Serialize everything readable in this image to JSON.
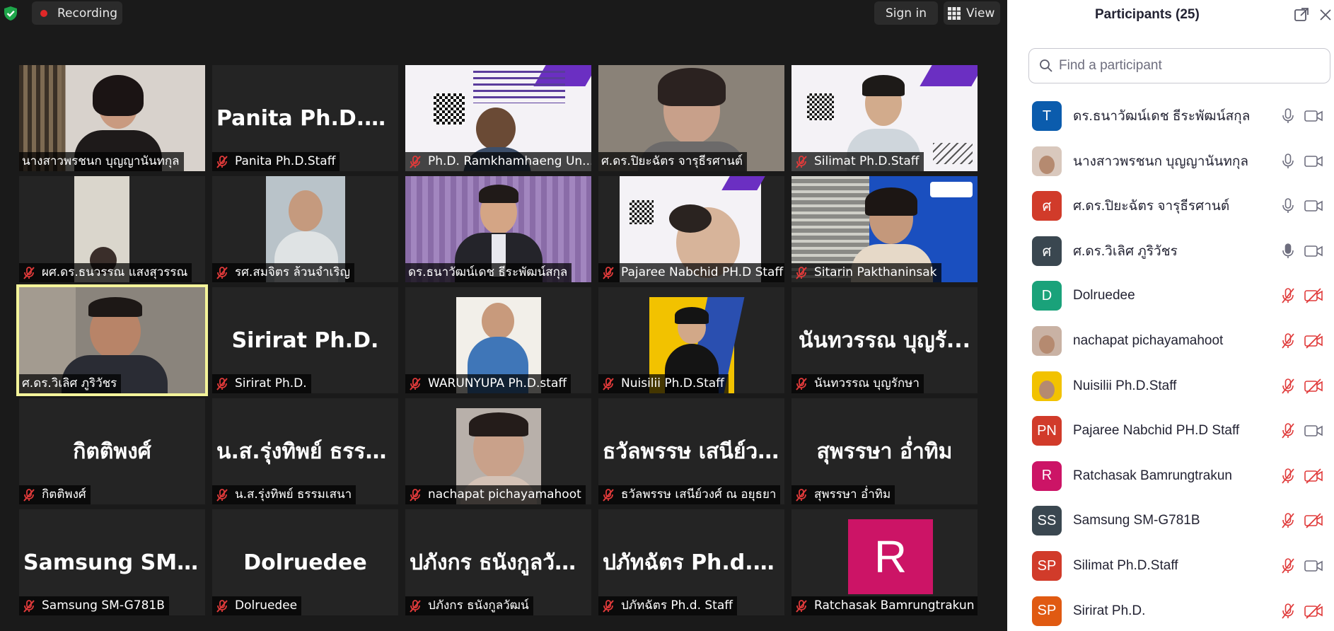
{
  "topbar": {
    "recording_label": "Recording",
    "signin_label": "Sign in",
    "view_label": "View",
    "colors": {
      "recording_dot": "#e02828",
      "shield": "#1ea54a"
    }
  },
  "tiles": [
    {
      "name": "นางสาวพรชนก บุญญานันทกุล",
      "muted": false,
      "kind": "video",
      "scene": "woman-office"
    },
    {
      "name": "Panita Ph.D.Staff",
      "muted": true,
      "kind": "text",
      "big": "Panita Ph.D.Staff"
    },
    {
      "name": "Ph.D. Ramkhamhaeng Un...",
      "muted": true,
      "kind": "video",
      "scene": "poster-man"
    },
    {
      "name": "ศ.ดร.ปิยะฉัตร จารุธีรศานต์",
      "muted": false,
      "kind": "video",
      "scene": "woman-glasses"
    },
    {
      "name": "Silimat Ph.D.Staff",
      "muted": true,
      "kind": "video",
      "scene": "poster-person"
    },
    {
      "name": "ผศ.ดร.ธนวรรณ แสงสุวรรณ",
      "muted": true,
      "kind": "video",
      "scene": "dark-room"
    },
    {
      "name": "รศ.สมจิตร ล้วนจำเริญ",
      "muted": true,
      "kind": "video",
      "scene": "older-man"
    },
    {
      "name": "ดร.ธนาวัฒน์เดช ธีระพัฒน์สกุล",
      "muted": false,
      "kind": "video",
      "scene": "man-purple"
    },
    {
      "name": "Pajaree Nabchid PH.D Staff",
      "muted": true,
      "kind": "video",
      "scene": "poster-face"
    },
    {
      "name": "Sitarin Pakthaninsak",
      "muted": true,
      "kind": "video",
      "scene": "blue-phd"
    },
    {
      "name": "ศ.ดร.วิเลิศ ภูริวัชร",
      "muted": false,
      "kind": "video",
      "scene": "speaker",
      "active": true
    },
    {
      "name": "Sirirat Ph.D.",
      "muted": true,
      "kind": "text",
      "big": "Sirirat Ph.D."
    },
    {
      "name": "WARUNYUPA Ph.D.staff",
      "muted": true,
      "kind": "video",
      "scene": "photo-woman"
    },
    {
      "name": "Nuisilii Ph.D.Staff",
      "muted": true,
      "kind": "video",
      "scene": "phd-yellow"
    },
    {
      "name": "นันทวรรณ บุญรักษา",
      "muted": true,
      "kind": "text",
      "big": "นันทวรรณ บุญรั..."
    },
    {
      "name": "กิตติพงศ์",
      "muted": true,
      "kind": "text",
      "big": "กิตติพงศ์"
    },
    {
      "name": "น.ส.รุ่งทิพย์ ธรรมเสนา",
      "muted": true,
      "kind": "text",
      "big": "น.ส.รุ่งทิพย์ ธรรม..."
    },
    {
      "name": "nachapat pichayamahoot",
      "muted": true,
      "kind": "video",
      "scene": "photo-glasses"
    },
    {
      "name": "ธวัลพรรษ เสนีย์วงศ์ ณ อยุธยา",
      "muted": true,
      "kind": "text",
      "big": "ธวัลพรรษ เสนีย์ว..."
    },
    {
      "name": "สุพรรษา อ่ำทิม",
      "muted": true,
      "kind": "text",
      "big": "สุพรรษา อ่ำทิม"
    },
    {
      "name": "Samsung SM-G781B",
      "muted": true,
      "kind": "text",
      "big": "Samsung  SM-G..."
    },
    {
      "name": "Dolruedee",
      "muted": true,
      "kind": "text",
      "big": "Dolruedee"
    },
    {
      "name": "ปภังกร ธนังกูลวัฒน์",
      "muted": true,
      "kind": "text",
      "big": "ปภังกร ธนังกูลวัฒน์"
    },
    {
      "name": "ปภัทฉัตร Ph.d. Staff",
      "muted": true,
      "kind": "text",
      "big": "ปภัทฉัตร Ph.d. S..."
    },
    {
      "name": "Ratchasak Bamrungtrakun",
      "muted": true,
      "kind": "avatar",
      "big": "R",
      "color": "#cc1466"
    }
  ],
  "panel": {
    "title": "Participants (25)",
    "search_placeholder": "Find a participant",
    "participants": [
      {
        "name": "ดร.ธนาวัฒน์เดช ธีระพัฒน์สกุล",
        "initials": "T",
        "color": "#0b5cad",
        "mic": "on",
        "cam": "on"
      },
      {
        "name": "นางสาวพรชนก บุญญานันทกุล",
        "initials": "",
        "color": "#d9c8bd",
        "photo": true,
        "mic": "on",
        "cam": "on"
      },
      {
        "name": "ศ.ดร.ปิยะฉัตร จารุธีรศานต์",
        "initials": "ศ",
        "color": "#d13b2a",
        "mic": "on",
        "cam": "on"
      },
      {
        "name": "ศ.ดร.วิเลิศ ภูริวัชร",
        "initials": "ศ",
        "color": "#3a4750",
        "mic": "active",
        "cam": "on"
      },
      {
        "name": "Dolruedee",
        "initials": "D",
        "color": "#1aa27a",
        "mic": "off",
        "cam": "off"
      },
      {
        "name": "nachapat pichayamahoot",
        "initials": "",
        "color": "#c9b2a4",
        "photo": true,
        "mic": "off",
        "cam": "off"
      },
      {
        "name": "Nuisilii Ph.D.Staff",
        "initials": "",
        "color": "#f2c200",
        "photo": true,
        "mic": "off",
        "cam": "off"
      },
      {
        "name": "Pajaree Nabchid PH.D Staff",
        "initials": "PN",
        "color": "#d13b2a",
        "mic": "off",
        "cam": "on"
      },
      {
        "name": "Ratchasak Bamrungtrakun",
        "initials": "R",
        "color": "#cc1466",
        "mic": "off",
        "cam": "off"
      },
      {
        "name": "Samsung SM-G781B",
        "initials": "SS",
        "color": "#3a4750",
        "mic": "off",
        "cam": "off"
      },
      {
        "name": "Silimat Ph.D.Staff",
        "initials": "SP",
        "color": "#d13b2a",
        "mic": "off",
        "cam": "on"
      },
      {
        "name": "Sirirat Ph.D.",
        "initials": "SP",
        "color": "#e05a12",
        "mic": "off",
        "cam": "off"
      }
    ]
  }
}
